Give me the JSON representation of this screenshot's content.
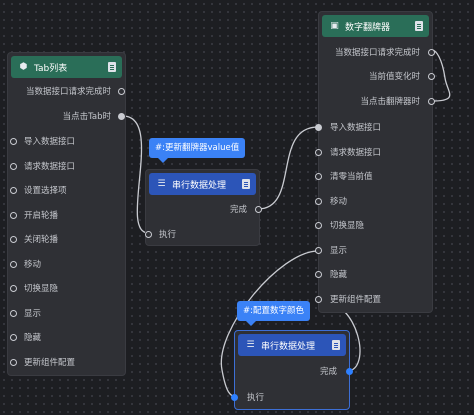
{
  "nodes": {
    "tab_list": {
      "title": "Tab列表",
      "outputs": [
        "当数据接口请求完成时",
        "当点击Tab时"
      ],
      "inputs": [
        "导入数据接口",
        "请求数据接口",
        "设置选择项",
        "开启轮播",
        "关闭轮播",
        "移动",
        "切换显隐",
        "显示",
        "隐藏",
        "更新组件配置"
      ]
    },
    "serial_top": {
      "title": "串行数据处理",
      "outputs": [
        "完成"
      ],
      "inputs": [
        "执行"
      ],
      "tag": "#:更新翻牌器value值"
    },
    "digit_flip": {
      "title": "数字翻牌器",
      "outputs": [
        "当数据接口请求完成时",
        "当前值变化时",
        "当点击翻牌器时"
      ],
      "inputs": [
        "导入数据接口",
        "请求数据接口",
        "清零当前值",
        "移动",
        "切换显隐",
        "显示",
        "隐藏",
        "更新组件配置"
      ]
    },
    "serial_bottom": {
      "title": "串行数据处理",
      "outputs": [
        "完成"
      ],
      "inputs": [
        "执行"
      ],
      "tag": "#:配置数字颜色"
    }
  },
  "colors": {
    "canvas": "#1d1e22",
    "node": "#2f3035",
    "header_green": "#2a6e58",
    "header_blue": "#2c55b8",
    "tag": "#3b82f6",
    "wire": "#c9cbd1",
    "selected_wire": "#2f80ff"
  }
}
